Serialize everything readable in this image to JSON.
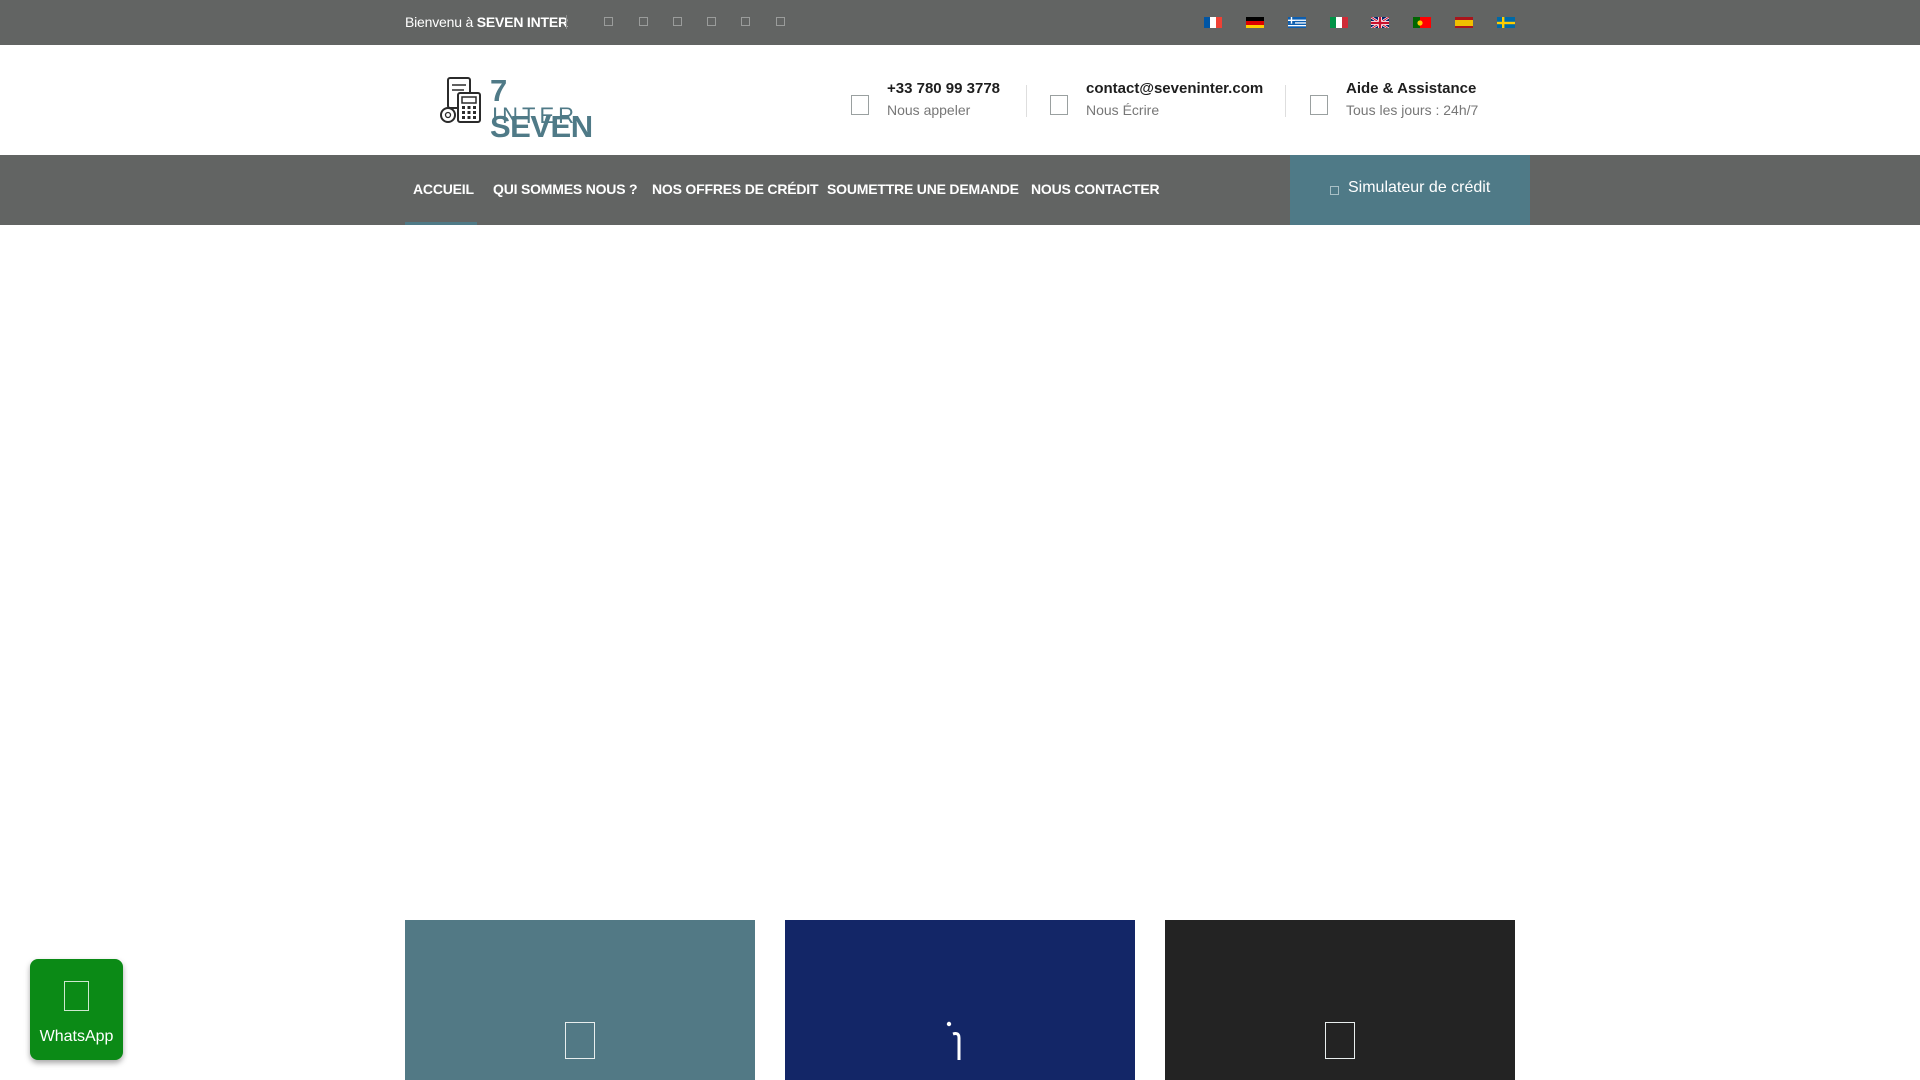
{
  "topbar": {
    "welcome_prefix": "Bienvenu à",
    "welcome_brand": "SEVEN INTER",
    "social_icons": [
      "social-icon-1",
      "social-icon-2",
      "social-icon-3",
      "social-icon-4",
      "social-icon-5",
      "social-icon-6"
    ],
    "languages": [
      "Français",
      "Deutsch",
      "Ελληνικά",
      "Italiano",
      "English",
      "Português",
      "Español",
      "Svenska"
    ]
  },
  "header": {
    "logo": {
      "number": "7",
      "line1": "SEVEN",
      "line2": "INTER"
    },
    "contacts": [
      {
        "title": "+33 780 99 3778",
        "subtitle": "Nous appeler",
        "icon": "phone-icon"
      },
      {
        "title": "contact@seveninter.com",
        "subtitle": "Nous Écrire",
        "icon": "email-icon"
      },
      {
        "title": "Aide & Assistance",
        "subtitle": "Tous les jours : 24h/7",
        "icon": "support-icon"
      }
    ]
  },
  "nav": {
    "items": [
      "ACCUEIL",
      "QUI SOMMES NOUS ?",
      "NOS OFFRES DE CRÉDIT",
      "SOUMETTRE UNE DEMANDE",
      "NOUS CONTACTER"
    ],
    "active": "ACCUEIL",
    "simulator_label": "Simulateur de crédit"
  },
  "cards": [
    {
      "icon": "card-icon-1",
      "color": "#527985"
    },
    {
      "icon": "card-icon-2",
      "color": "#132667"
    },
    {
      "icon": "card-icon-3",
      "color": "#232323"
    }
  ],
  "whatsapp": {
    "label": "WhatsApp",
    "color": "#0b8a16"
  },
  "colors": {
    "accent": "#4f7a87",
    "bar": "#626463"
  }
}
